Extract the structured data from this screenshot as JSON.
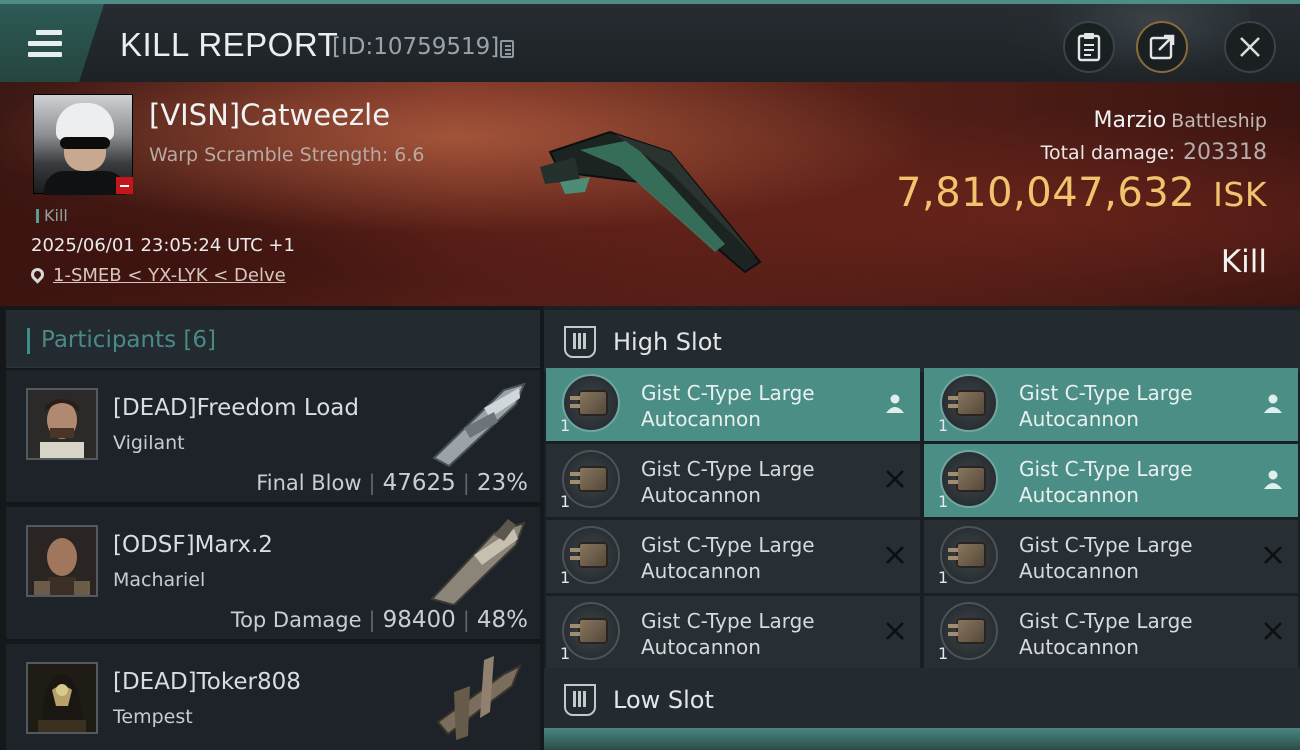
{
  "header": {
    "title": "KILL REPORT",
    "report_id": "[ID:10759519]",
    "icons": [
      "menu-icon",
      "copy-icon",
      "clipboard-icon",
      "share-icon",
      "close-icon"
    ]
  },
  "victim": {
    "name": "[VISN]Catweezle",
    "scramble": "Warp Scramble Strength: 6.6",
    "tag": "Kill",
    "timestamp": "2025/06/01 23:05:24 UTC +1",
    "location": "1-SMEB < YX-LYK < Delve",
    "ship_name": "Marzio",
    "ship_class": "Battleship",
    "damage_label": "Total damage:",
    "damage_value": "203318",
    "isk_value": "7,810,047,632",
    "isk_unit": "ISK",
    "result": "Kill"
  },
  "participants": {
    "label": "Participants",
    "count": "[6]",
    "rows": [
      {
        "name": "[DEAD]Freedom Load",
        "ship": "Vigilant",
        "role": "Final Blow",
        "damage": "47625",
        "percent": "23%"
      },
      {
        "name": "[ODSF]Marx.2",
        "ship": "Machariel",
        "role": "Top Damage",
        "damage": "98400",
        "percent": "48%"
      },
      {
        "name": "[DEAD]Toker808",
        "ship": "Tempest",
        "role": "",
        "damage": "",
        "percent": ""
      }
    ]
  },
  "high_slot": {
    "label": "High Slot",
    "modules": [
      {
        "name": "Gist C-Type Large",
        "name2": "Autocannon",
        "qty": "1",
        "state": "dropped"
      },
      {
        "name": "Gist C-Type Large",
        "name2": "Autocannon",
        "qty": "1",
        "state": "dropped"
      },
      {
        "name": "Gist C-Type Large",
        "name2": "Autocannon",
        "qty": "1",
        "state": "destroyed"
      },
      {
        "name": "Gist C-Type Large",
        "name2": "Autocannon",
        "qty": "1",
        "state": "dropped"
      },
      {
        "name": "Gist C-Type Large",
        "name2": "Autocannon",
        "qty": "1",
        "state": "destroyed"
      },
      {
        "name": "Gist C-Type Large",
        "name2": "Autocannon",
        "qty": "1",
        "state": "destroyed"
      },
      {
        "name": "Gist C-Type Large",
        "name2": "Autocannon",
        "qty": "1",
        "state": "destroyed"
      },
      {
        "name": "Gist C-Type Large",
        "name2": "Autocannon",
        "qty": "1",
        "state": "destroyed"
      }
    ]
  },
  "low_slot": {
    "label": "Low Slot"
  },
  "colors": {
    "accent": "#4b8e86",
    "isk": "#f1c36d",
    "banner": "#6e2a20"
  }
}
